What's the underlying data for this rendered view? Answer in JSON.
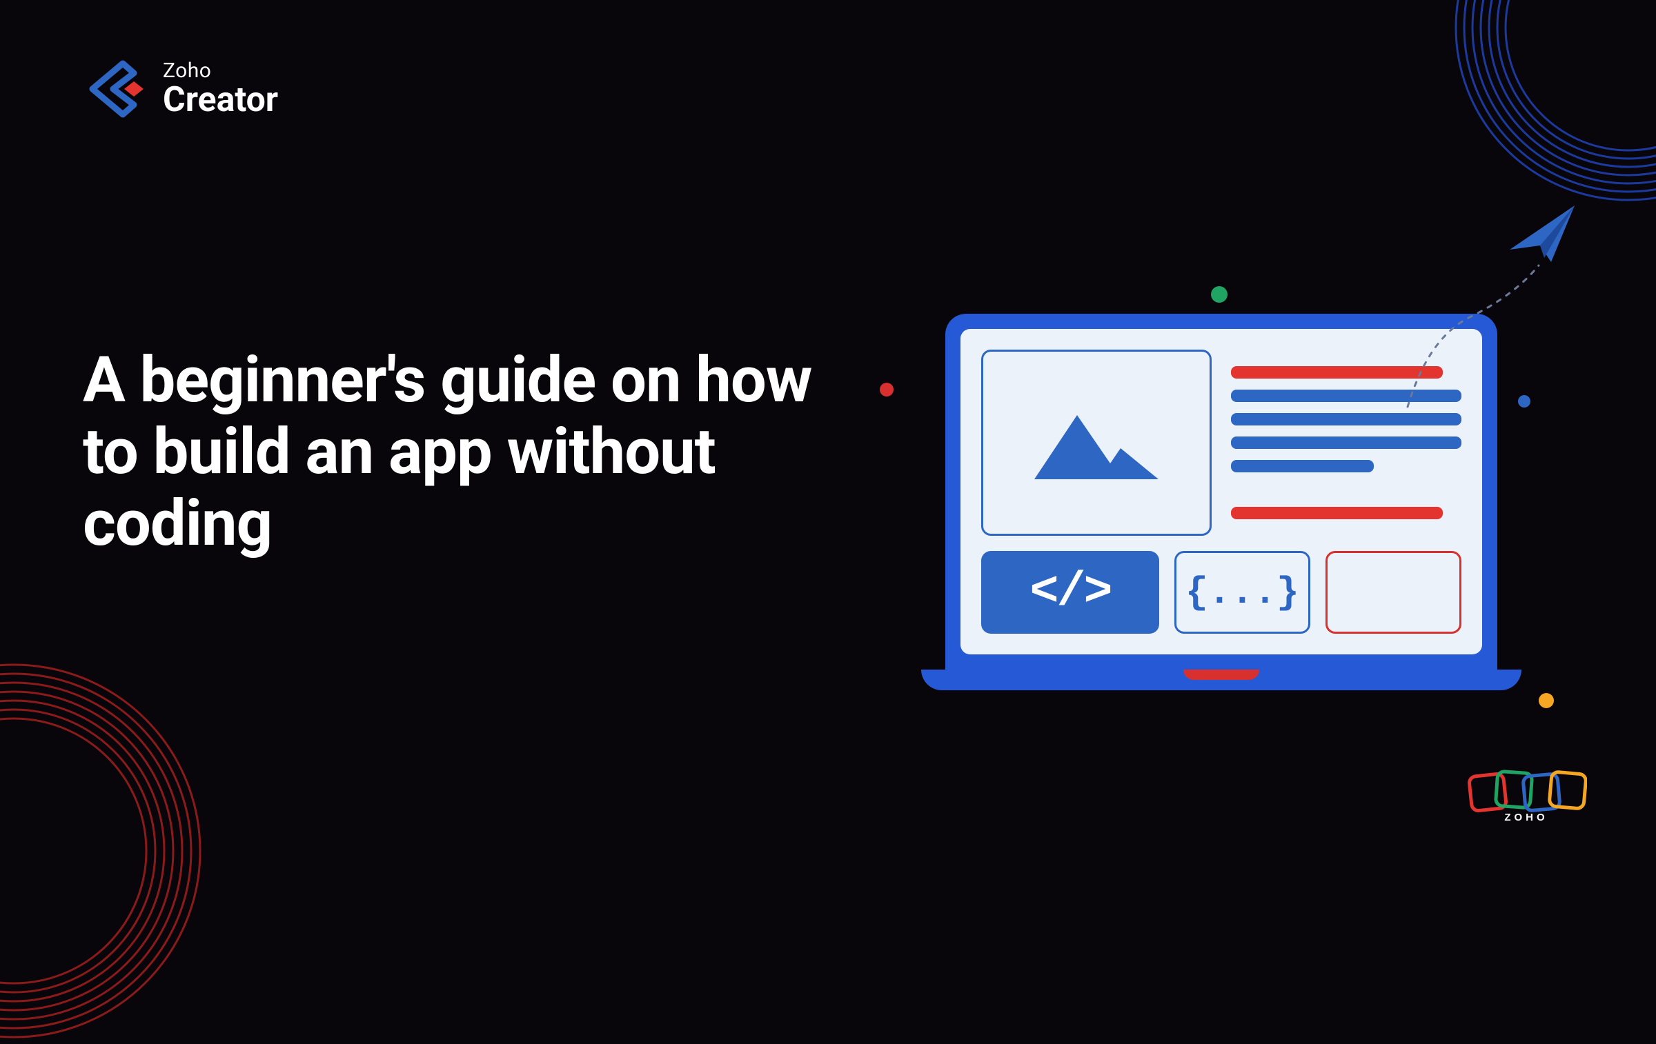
{
  "logo": {
    "brand_top": "Zoho",
    "brand_bottom": "Creator"
  },
  "headline": "A beginner's guide on how to build an app without coding",
  "laptop_screen": {
    "code_tag": "</>",
    "json_tag": "{...}"
  },
  "footer_brand": "ZOHO",
  "colors": {
    "bg": "#08060a",
    "blue_primary": "#2659d6",
    "blue_accent": "#2d66c3",
    "red": "#e4342f",
    "green": "#1fa463",
    "yellow": "#f5a623",
    "screen_bg": "#ecf2fa"
  }
}
